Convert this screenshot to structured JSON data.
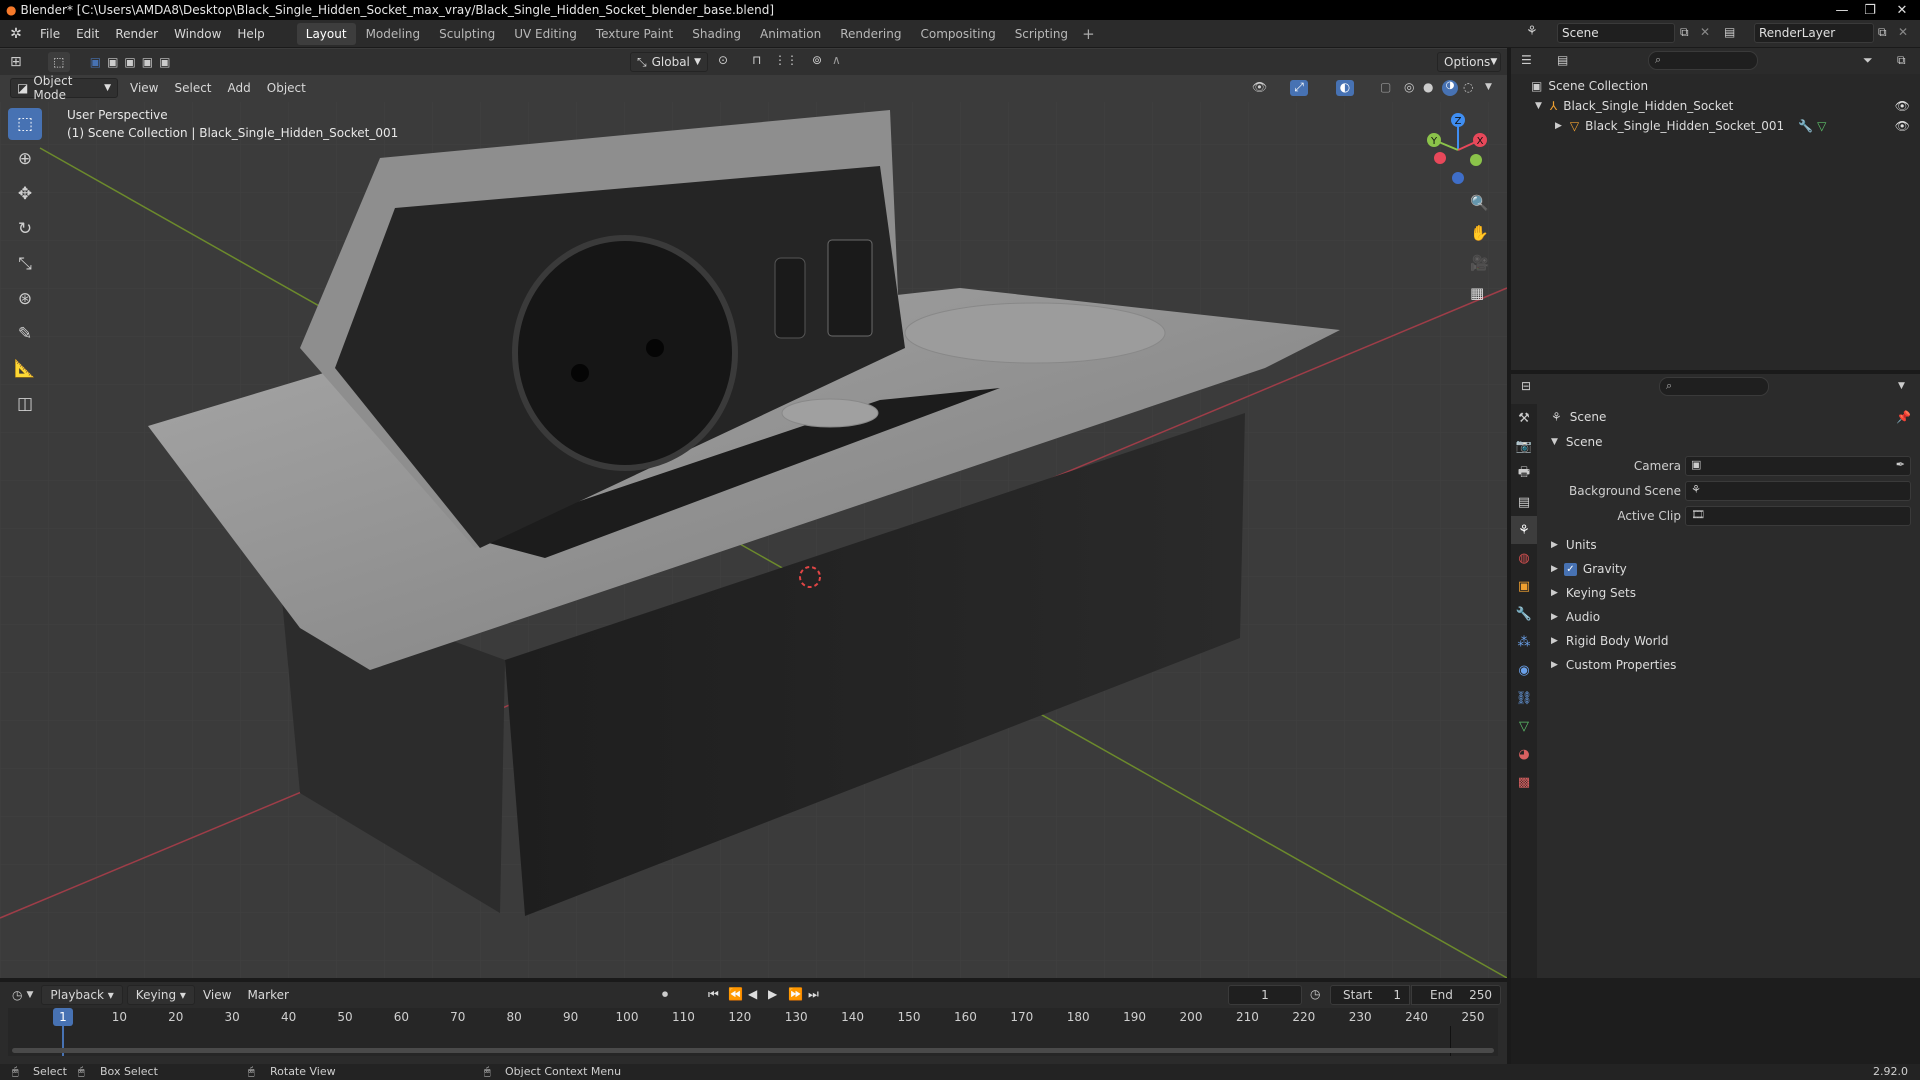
{
  "window": {
    "title": "Blender* [C:\\Users\\AMDA8\\Desktop\\Black_Single_Hidden_Socket_max_vray/Black_Single_Hidden_Socket_blender_base.blend]"
  },
  "menus": [
    "File",
    "Edit",
    "Render",
    "Window",
    "Help"
  ],
  "workspaces": [
    {
      "label": "Layout",
      "active": true
    },
    {
      "label": "Modeling",
      "active": false
    },
    {
      "label": "Sculpting",
      "active": false
    },
    {
      "label": "UV Editing",
      "active": false
    },
    {
      "label": "Texture Paint",
      "active": false
    },
    {
      "label": "Shading",
      "active": false
    },
    {
      "label": "Animation",
      "active": false
    },
    {
      "label": "Rendering",
      "active": false
    },
    {
      "label": "Compositing",
      "active": false
    },
    {
      "label": "Scripting",
      "active": false
    }
  ],
  "scene_selector": {
    "scene": "Scene",
    "view_layer": "RenderLayer"
  },
  "viewport": {
    "transform_orientation": "Global",
    "options_label": "Options",
    "mode": "Object Mode",
    "header_menus": [
      "View",
      "Select",
      "Add",
      "Object"
    ],
    "overlay_line1": "User Perspective",
    "overlay_line2": "(1) Scene Collection | Black_Single_Hidden_Socket_001",
    "gizmo_axes": [
      "X",
      "Y",
      "Z"
    ]
  },
  "outliner": {
    "root": "Scene Collection",
    "items": [
      {
        "label": "Black_Single_Hidden_Socket",
        "level": 1
      },
      {
        "label": "Black_Single_Hidden_Socket_001",
        "level": 2
      }
    ]
  },
  "properties": {
    "context": "Scene",
    "panel": "Scene",
    "fields": [
      {
        "label": "Camera"
      },
      {
        "label": "Background Scene"
      },
      {
        "label": "Active Clip"
      }
    ],
    "sections": [
      {
        "label": "Units",
        "checkbox": false
      },
      {
        "label": "Gravity",
        "checkbox": true
      },
      {
        "label": "Keying Sets",
        "checkbox": false
      },
      {
        "label": "Audio",
        "checkbox": false
      },
      {
        "label": "Rigid Body World",
        "checkbox": false
      },
      {
        "label": "Custom Properties",
        "checkbox": false
      }
    ]
  },
  "timeline": {
    "menus": [
      "Playback",
      "Keying",
      "View",
      "Marker"
    ],
    "current_frame": "1",
    "start_label": "Start",
    "start": "1",
    "end_label": "End",
    "end": "250",
    "playhead": "1",
    "ticks": [
      "10",
      "20",
      "30",
      "40",
      "50",
      "60",
      "70",
      "80",
      "90",
      "100",
      "110",
      "120",
      "130",
      "140",
      "150",
      "160",
      "170",
      "180",
      "190",
      "200",
      "210",
      "220",
      "230",
      "240",
      "250"
    ]
  },
  "statusbar": {
    "items": [
      "Select",
      "Box Select",
      "Rotate View",
      "Object Context Menu"
    ],
    "version": "2.92.0"
  },
  "colors": {
    "accent": "#4772b3",
    "x_axis": "#e8485a",
    "y_axis": "#8bc34a",
    "z_axis": "#3f8ef2",
    "viewport_bg": "#3b3b3b"
  }
}
